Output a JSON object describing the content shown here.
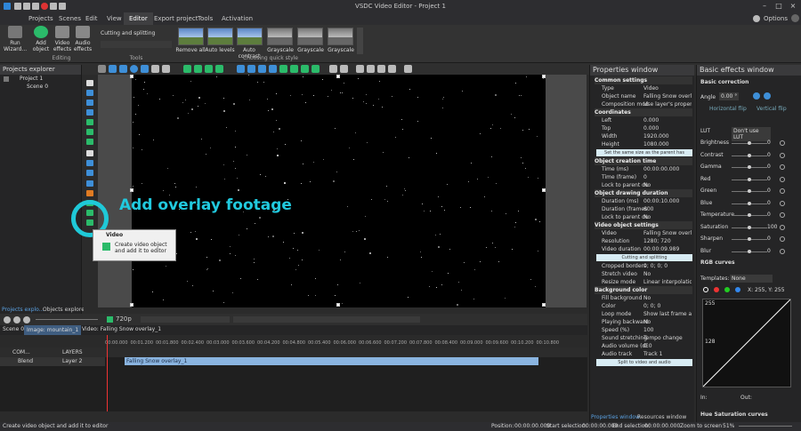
{
  "app": {
    "title": "VSDC Video Editor - Project 1"
  },
  "menu": [
    "Projects",
    "Scenes",
    "Edit",
    "View",
    "Editor",
    "Export project",
    "Tools",
    "Activation"
  ],
  "options_label": "Options",
  "ribbon": {
    "run_wizard": "Run\nWizard...",
    "add_object": "Add\nobject",
    "video_effects": "Video\neffects",
    "audio_effects": "Audio\neffects",
    "editing_label": "Editing",
    "cutting": "Cutting and splitting",
    "tools_label": "Tools",
    "quick_styles": [
      "Remove all",
      "Auto levels",
      "Auto contrast",
      "Grayscale",
      "Grayscale",
      "Grayscale",
      "Grayscale"
    ],
    "quick_style_label": "Choosing quick style"
  },
  "projects_explorer": {
    "title": "Projects explorer",
    "project": "Project 1",
    "scene": "Scene 0",
    "tab1": "Projects explo...",
    "tab2": "Objects explorer"
  },
  "overlay_annotation": "Add overlay footage",
  "popup": {
    "title": "Video",
    "desc": "Create video object and add it to editor"
  },
  "player": {
    "resolution": "720p"
  },
  "timeline": {
    "tabs": [
      "Scene 0",
      "Image: mountain_1",
      "Video: Falling Snow overlay_1"
    ],
    "ruler": [
      "00:00.000",
      "00:01.200",
      "00:01.800",
      "00:02.400",
      "00:03.000",
      "00:03.600",
      "00:04.200",
      "00:04.800",
      "00:05.400",
      "00:06.000",
      "00:06.600",
      "00:07.200",
      "00:07.800",
      "00:08.400",
      "00:09.000",
      "00:09.600",
      "00:10.200",
      "00:10.800"
    ],
    "row1_name": "COM...",
    "row1_layer": "LAYERS",
    "row2_blend": "Blend",
    "row2_layer": "Layer 2",
    "clip_label": "Falling Snow overlay_1"
  },
  "properties": {
    "title": "Properties window",
    "common": "Common settings",
    "rows1": [
      [
        "Type",
        "Video"
      ],
      [
        "Object name",
        "Falling Snow overlay_"
      ],
      [
        "Composition mode",
        "Use layer's properties"
      ]
    ],
    "coords": "Coordinates",
    "rows2": [
      [
        "Left",
        "0.000"
      ],
      [
        "Top",
        "0.000"
      ],
      [
        "Width",
        "1920.000"
      ],
      [
        "Height",
        "1080.000"
      ]
    ],
    "same_size": "Set the same size as the parent has",
    "creation": "Object creation time",
    "rows3": [
      [
        "Time (ms)",
        "00:00:00.000"
      ],
      [
        "Time (frame)",
        "0"
      ],
      [
        "Lock to parent du",
        "No"
      ]
    ],
    "drawing": "Object drawing duration",
    "rows4": [
      [
        "Duration (ms)",
        "00:00:10.000"
      ],
      [
        "Duration (frames)",
        "600"
      ],
      [
        "Lock to parent du",
        "No"
      ]
    ],
    "video_settings": "Video object settings",
    "rows5": [
      [
        "Video",
        "Falling Snow overla"
      ],
      [
        "Resolution",
        "1280; 720"
      ],
      [
        "Video duration",
        "00:00:09.989"
      ]
    ],
    "cutting": "Cutting and splitting",
    "rows6": [
      [
        "Cropped borders",
        "0; 0; 0; 0"
      ],
      [
        "Stretch video",
        "No"
      ],
      [
        "Resize mode",
        "Linear interpolation"
      ]
    ],
    "bg_color": "Background color",
    "rows7": [
      [
        "Fill background",
        "No"
      ],
      [
        "Color",
        "0; 0; 0"
      ]
    ],
    "rows8": [
      [
        "Loop mode",
        "Show last frame at the"
      ],
      [
        "Playing backwards",
        "No"
      ],
      [
        "Speed (%)",
        "100"
      ],
      [
        "Sound stretching m",
        "Tempo change"
      ],
      [
        "Audio volume (dB)",
        "0.0"
      ],
      [
        "Audio track",
        "Track 1"
      ]
    ],
    "split": "Split to video and audio",
    "tab1": "Properties window",
    "tab2": "Resources window"
  },
  "effects": {
    "title": "Basic effects window",
    "basic": "Basic correction",
    "angle_label": "Angle",
    "angle_val": "0.00 °",
    "hflip": "Horizontal flip",
    "vflip": "Vertical flip",
    "lut_label": "LUT",
    "lut_val": "Don't use LUT",
    "sliders": [
      [
        "Brightness",
        "0"
      ],
      [
        "Contrast",
        "0"
      ],
      [
        "Gamma",
        "0"
      ],
      [
        "Red",
        "0"
      ],
      [
        "Green",
        "0"
      ],
      [
        "Blue",
        "0"
      ],
      [
        "Temperature",
        "0"
      ],
      [
        "Saturation",
        "100"
      ],
      [
        "Sharpen",
        "0"
      ],
      [
        "Blur",
        "0"
      ]
    ],
    "rgb": "RGB curves",
    "templates": "Templates:",
    "templates_val": "None",
    "coords": "X: 255, Y: 255",
    "curve_top": "255",
    "curve_mid": "128",
    "in_label": "In:",
    "out_label": "Out:",
    "hue": "Hue Saturation curves"
  },
  "status": {
    "left": "Create video object and add it to editor",
    "position": "Position:",
    "pos_val": "00:00:00.000",
    "start": "Start selection:",
    "start_val": "00:00:00.000",
    "end": "End selection:",
    "end_val": "00:00:00.000",
    "zoom": "Zoom to screen",
    "zoom_val": "51%"
  },
  "colors": {
    "accent": "#1fc9d8",
    "clip": "#8ab4e0"
  }
}
